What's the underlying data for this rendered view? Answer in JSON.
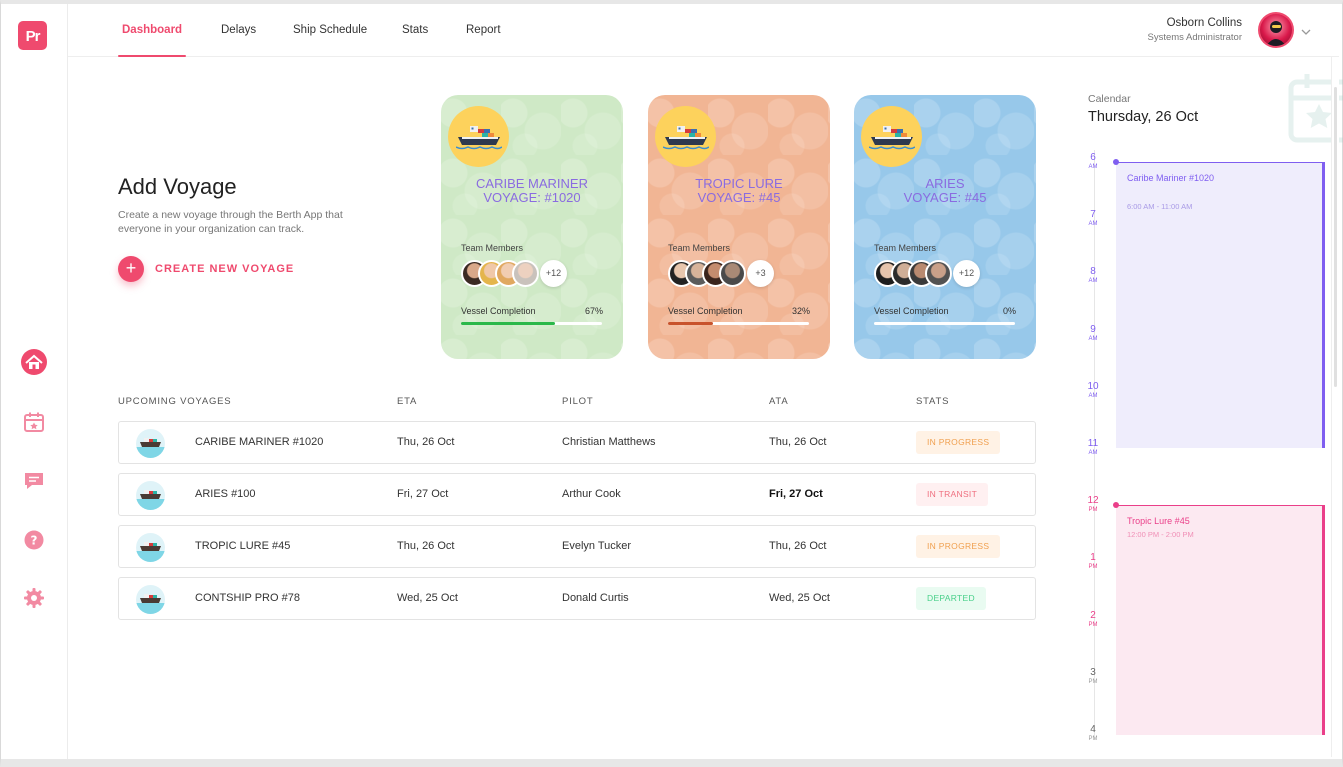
{
  "brand": {
    "logo_text": "Pr",
    "accent": "#ef4a6e"
  },
  "nav": {
    "tabs": [
      {
        "label": "Dashboard",
        "active": true
      },
      {
        "label": "Delays",
        "active": false
      },
      {
        "label": "Ship Schedule",
        "active": false
      },
      {
        "label": "Stats",
        "active": false
      },
      {
        "label": "Report",
        "active": false
      }
    ]
  },
  "user": {
    "name": "Osborn Collins",
    "role": "Systems Administrator",
    "menu_icon": "chevron-down-icon"
  },
  "sidebar": {
    "icons": [
      "home-icon",
      "calendar-icon",
      "chat-icon",
      "help-icon",
      "settings-icon"
    ],
    "active": "home-icon"
  },
  "add_voyage": {
    "title": "Add Voyage",
    "description": "Create a new voyage through the Berth App that everyone in your organization can track.",
    "button_label": "CREATE NEW VOYAGE",
    "button_icon": "plus-icon"
  },
  "voyage_cards": [
    {
      "name_line1": "CARIBE MARINER",
      "name_line2": "VOYAGE: #1020",
      "team_label": "Team Members",
      "more": "+12",
      "completion_label": "Vessel Completion",
      "completion_pct": "67%",
      "completion_value": 0.67,
      "bg": "#cfe9c6",
      "bar": "#2bb84a"
    },
    {
      "name_line1": "TROPIC LURE",
      "name_line2": "VOYAGE: #45",
      "team_label": "Team Members",
      "more": "+3",
      "completion_label": "Vessel Completion",
      "completion_pct": "32%",
      "completion_value": 0.32,
      "bg": "#f1b594",
      "bar": "#c8532c"
    },
    {
      "name_line1": "ARIES",
      "name_line2": "VOYAGE: #45",
      "team_label": "Team Members",
      "more": "+12",
      "completion_label": "Vessel Completion",
      "completion_pct": "0%",
      "completion_value": 0,
      "bg": "#97c8ea",
      "bar": "#2a6db8"
    }
  ],
  "table": {
    "headers": {
      "voyage": "UPCOMING VOYAGES",
      "eta": "ETA",
      "pilot": "PILOT",
      "ata": "ATA",
      "stats": "STATS"
    },
    "rows": [
      {
        "voyage": "CARIBE MARINER #1020",
        "eta": "Thu, 26 Oct",
        "pilot": "Christian Matthews",
        "ata": "Thu, 26 Oct",
        "status": "IN PROGRESS",
        "status_kind": "progress"
      },
      {
        "voyage": "ARIES #100",
        "eta": "Fri, 27 Oct",
        "pilot": "Arthur Cook",
        "ata": "Fri, 27 Oct",
        "status": "IN TRANSIT",
        "status_kind": "transit"
      },
      {
        "voyage": "TROPIC LURE #45",
        "eta": "Thu, 26 Oct",
        "pilot": "Evelyn Tucker",
        "ata": "Thu, 26 Oct",
        "status": "IN PROGRESS",
        "status_kind": "progress"
      },
      {
        "voyage": "CONTSHIP PRO #78",
        "eta": "Wed, 25 Oct",
        "pilot": "Donald Curtis",
        "ata": "Wed, 25 Oct",
        "status": "DEPARTED",
        "status_kind": "departed"
      }
    ]
  },
  "calendar": {
    "label": "Calendar",
    "date": "Thursday, 26 Oct",
    "hours": [
      {
        "h": "6",
        "m": "AM"
      },
      {
        "h": "7",
        "m": "AM"
      },
      {
        "h": "8",
        "m": "AM"
      },
      {
        "h": "9",
        "m": "AM"
      },
      {
        "h": "10",
        "m": "AM"
      },
      {
        "h": "11",
        "m": "AM"
      },
      {
        "h": "12",
        "m": "PM"
      },
      {
        "h": "1",
        "m": "PM"
      },
      {
        "h": "2",
        "m": "PM"
      },
      {
        "h": "3",
        "m": "PM"
      },
      {
        "h": "4",
        "m": "PM"
      }
    ],
    "events": [
      {
        "title": "Caribe Mariner #1020",
        "time": "6:00 AM - 11:00 AM",
        "color": "#7f5ef0",
        "bg": "#efedfc"
      },
      {
        "title": "Tropic Lure #45",
        "time": "12:00 PM - 2:00 PM",
        "color": "#ea3f89",
        "bg": "#fce9f1"
      }
    ]
  }
}
